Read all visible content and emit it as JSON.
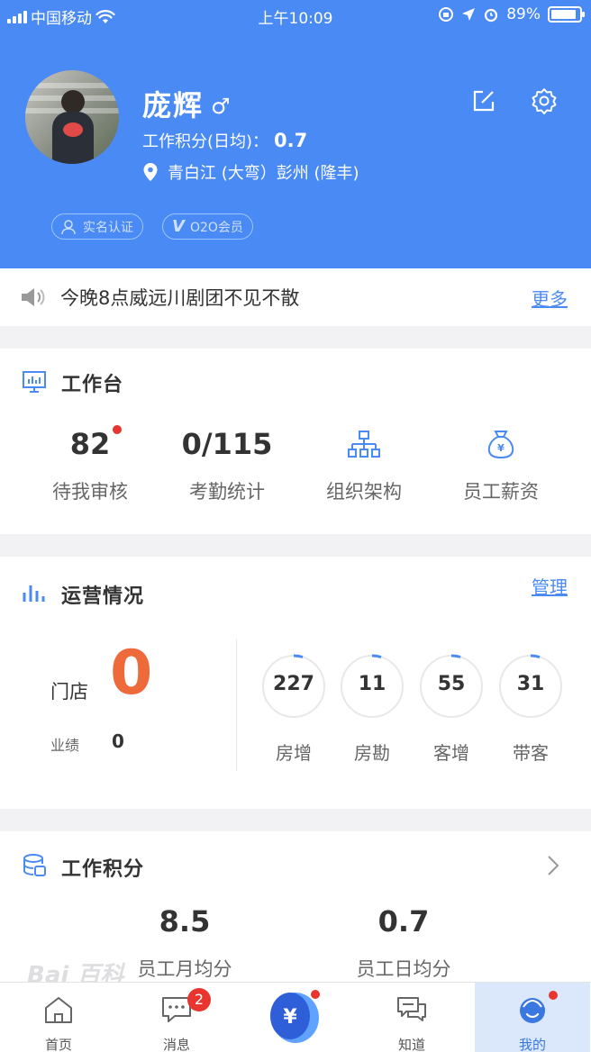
{
  "status_bar": {
    "carrier": "中国移动",
    "time": "上午10:09",
    "battery": "89%",
    "battery_level": 0.89
  },
  "profile": {
    "name": "庞辉",
    "gender_symbol": "♂",
    "score_label": "工作积分(日均)：",
    "score_value": "0.7",
    "location": "青白江 (大弯）彭州 (隆丰)",
    "badges": [
      "实名认证",
      "O2O会员"
    ]
  },
  "notice": {
    "text": "今晚8点威远川剧团不见不散",
    "more": "更多"
  },
  "workbench": {
    "title": "工作台",
    "items": [
      {
        "value": "82",
        "label": "待我审核"
      },
      {
        "value": "0/115",
        "label": "考勤统计"
      },
      {
        "label": "组织架构",
        "icon": "org-chart-icon"
      },
      {
        "label": "员工薪资",
        "icon": "money-bag-icon"
      }
    ]
  },
  "operations": {
    "title": "运营情况",
    "manage": "管理",
    "store_label": "门店",
    "store_value": "0",
    "performance_label": "业绩",
    "performance_value": "0",
    "metrics": [
      {
        "value": "227",
        "label": "房增"
      },
      {
        "value": "11",
        "label": "房勘"
      },
      {
        "value": "55",
        "label": "客增"
      },
      {
        "value": "31",
        "label": "带客"
      }
    ]
  },
  "work_score": {
    "title": "工作积分",
    "items": [
      {
        "value": "8.5",
        "label": "员工月均分"
      },
      {
        "value": "0.7",
        "label": "员工日均分"
      }
    ]
  },
  "watermark": "Bai 百科",
  "tabbar": {
    "items": [
      {
        "label": "首页",
        "icon": "home-icon"
      },
      {
        "label": "消息",
        "icon": "message-icon",
        "badge": "2"
      },
      {
        "label": "",
        "icon": "yuan-center-icon"
      },
      {
        "label": "知道",
        "icon": "chat-bubbles-icon"
      },
      {
        "label": "我的",
        "icon": "user-face-icon",
        "active": true
      }
    ]
  },
  "colors": {
    "primary": "#4a8af4",
    "accent_orange": "#ef6a3b",
    "red_dot": "#e8352f"
  }
}
